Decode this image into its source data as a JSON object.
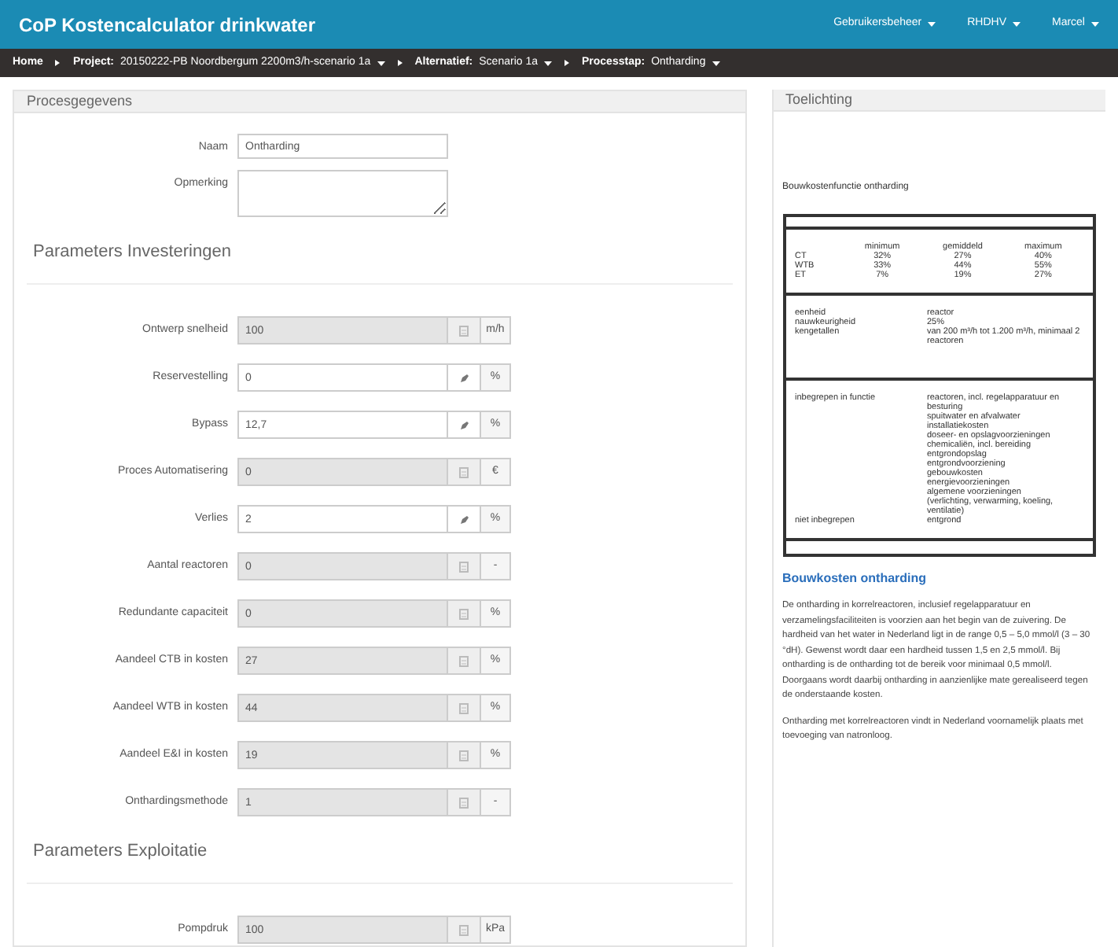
{
  "app": {
    "title": "CoP Kostencalculator drinkwater",
    "menus": [
      "Gebruikersbeheer",
      "RHDHV",
      "Marcel"
    ]
  },
  "breadcrumb": [
    {
      "label": "Home"
    },
    {
      "label": "Project:",
      "value": "20150222-PB Noordbergum 2200m3/h-scenario 1a"
    },
    {
      "label": "Alternatief:",
      "value": "Scenario 1a"
    },
    {
      "label": "Processtap:",
      "value": "Ontharding"
    }
  ],
  "process": {
    "title": "Procesgegevens",
    "name_label": "Naam",
    "name_value": "Ontharding",
    "remark_label": "Opmerking",
    "sections": [
      {
        "title": "Parameters Investeringen",
        "fields": [
          {
            "label": "Ontwerp snelheid",
            "value": "100",
            "unit": "m/h",
            "disabled": true
          },
          {
            "label": "Reservestelling",
            "value": "0",
            "unit": "%",
            "disabled": false
          },
          {
            "label": "Bypass",
            "value": "12,7",
            "unit": "%",
            "disabled": false
          },
          {
            "label": "Proces Automatisering",
            "value": "0",
            "unit": "€",
            "disabled": true
          },
          {
            "label": "Verlies",
            "value": "2",
            "unit": "%",
            "disabled": false
          },
          {
            "label": "Aantal reactoren",
            "value": "0",
            "unit": "-",
            "disabled": true
          },
          {
            "label": "Redundante capaciteit",
            "value": "0",
            "unit": "%",
            "disabled": true
          },
          {
            "label": "Aandeel CTB in kosten",
            "value": "27",
            "unit": "%",
            "disabled": true
          },
          {
            "label": "Aandeel WTB in kosten",
            "value": "44",
            "unit": "%",
            "disabled": true
          },
          {
            "label": "Aandeel E&I in kosten",
            "value": "19",
            "unit": "%",
            "disabled": true
          },
          {
            "label": "Onthardingsmethode",
            "value": "1",
            "unit": "-",
            "disabled": true
          }
        ]
      },
      {
        "title": "Parameters Exploitatie",
        "fields": [
          {
            "label": "Pompdruk",
            "value": "100",
            "unit": "kPa",
            "disabled": true
          }
        ]
      }
    ]
  },
  "explanation": {
    "title": "Toelichting",
    "subtitle": "Bouwkostenfunctie ontharding",
    "share_table": {
      "columns": [
        "minimum",
        "gemiddeld",
        "maximum"
      ],
      "rows": [
        {
          "label": "CT",
          "values": [
            "32%",
            "27%",
            "40%"
          ]
        },
        {
          "label": "WTB",
          "values": [
            "33%",
            "44%",
            "55%"
          ]
        },
        {
          "label": "ET",
          "values": [
            "7%",
            "19%",
            "27%"
          ]
        }
      ]
    },
    "specs": [
      {
        "label": "eenheid",
        "value": "reactor"
      },
      {
        "label": "nauwkeurigheid",
        "value": "25%"
      },
      {
        "label": "kengetallen",
        "value": "van 200 m³/h tot 1.200 m³/h, minimaal 2 reactoren"
      }
    ],
    "scope": [
      {
        "label": "inbegrepen in functie",
        "items": [
          "reactoren, incl. regelapparatuur en besturing",
          "spuitwater en afvalwater",
          "installatiekosten",
          "doseer- en opslagvoorzieningen",
          "chemicaliën, incl. bereiding",
          "entgrondopslag",
          "entgrondvoorziening",
          "gebouwkosten",
          "energievoorzieningen",
          "algemene voorzieningen",
          "(verlichting, verwarming, koeling, ventilatie)"
        ]
      },
      {
        "label": "niet inbegrepen",
        "items": [
          "entgrond"
        ]
      }
    ],
    "link": "Bouwkosten ontharding",
    "paragraphs": [
      "De ontharding in korrelreactoren, inclusief regelapparatuur en verzamelingsfaciliteiten is voorzien aan het begin van de zuivering. De hardheid van het water in Nederland ligt in de range 0,5 – 5,0 mmol/l (3 – 30 °dH). Gewenst wordt daar een hardheid tussen 1,5 en 2,5 mmol/l. Bij ontharding is de ontharding tot de bereik voor minimaal 0,5 mmol/l. Doorgaans wordt daarbij ontharding in aanzienlijke mate gerealiseerd tegen de onderstaande kosten.",
      "Ontharding met korrelreactoren vindt in Nederland voornamelijk plaats met toevoeging van natronloog."
    ]
  }
}
